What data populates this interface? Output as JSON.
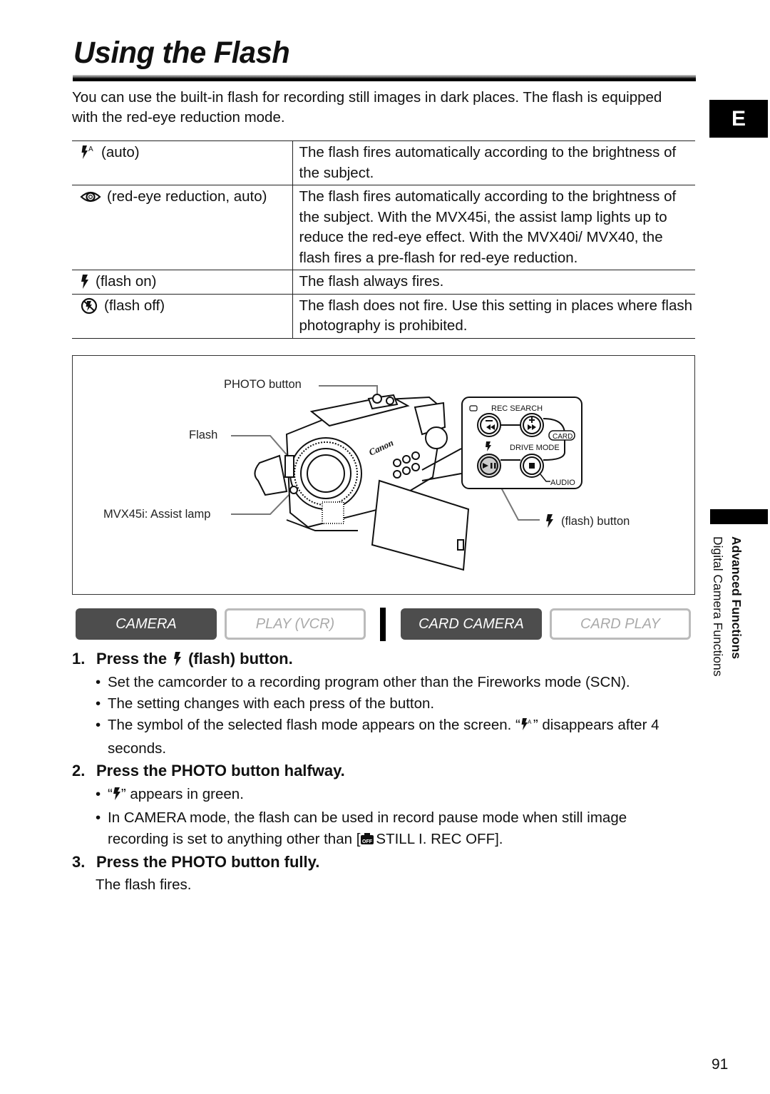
{
  "page": {
    "title": "Using the Flash",
    "intro": "You can use the built-in flash for recording still images in dark places. The flash is equipped with the red-eye reduction mode.",
    "language_tab": "E",
    "page_number": "91"
  },
  "modes_table": {
    "rows": [
      {
        "icon": "flash-auto-icon",
        "mode": "(auto)",
        "description": "The flash fires automatically according to the brightness of the subject."
      },
      {
        "icon": "red-eye-icon",
        "mode": "(red-eye reduction, auto)",
        "description": "The flash fires automatically according to the brightness of the subject. With the MVX45i, the assist lamp lights up to reduce the red-eye effect. With the MVX40i/ MVX40, the flash fires a pre-flash for red-eye reduction."
      },
      {
        "icon": "flash-on-icon",
        "mode": "(flash on)",
        "description": "The flash always fires."
      },
      {
        "icon": "flash-off-icon",
        "mode": "(flash off)",
        "description": "The flash does not fire. Use this setting in places where flash photography is prohibited."
      }
    ]
  },
  "figure": {
    "labels": {
      "photo_button": "PHOTO button",
      "flash": "Flash",
      "assist_lamp": "MVX45i: Assist lamp",
      "flash_button": "(flash) button"
    },
    "panel": {
      "rec_search": "REC SEARCH",
      "card": "CARD",
      "drive_mode": "DRIVE MODE",
      "audio": "AUDIO",
      "brand": "Canon"
    }
  },
  "mode_bar": [
    {
      "label": "CAMERA",
      "active": true
    },
    {
      "label": "PLAY (VCR)",
      "active": false
    },
    {
      "label": "CARD CAMERA",
      "active": true
    },
    {
      "label": "CARD PLAY",
      "active": false
    }
  ],
  "steps": [
    {
      "number": "1.",
      "title_pre": "Press the",
      "title_post": "(flash) button.",
      "bullets": [
        "Set the camcorder to a recording program other than the Fireworks mode (SCN).",
        "The setting changes with each press of the button.",
        "The symbol of the selected flash mode appears on the screen. “",
        "” disappears after 4 seconds."
      ]
    },
    {
      "number": "2.",
      "title": "Press the PHOTO button halfway.",
      "bullets": [
        "“",
        "” appears in green.",
        "In CAMERA mode, the flash can be used in record pause mode when still image recording is set to anything other than [",
        "STILL I. REC OFF]."
      ]
    },
    {
      "number": "3.",
      "title": "Press the PHOTO button fully.",
      "body": "The flash fires."
    }
  ],
  "sidebar": {
    "section": "Advanced Functions",
    "subsection": "Digital Camera Functions"
  }
}
